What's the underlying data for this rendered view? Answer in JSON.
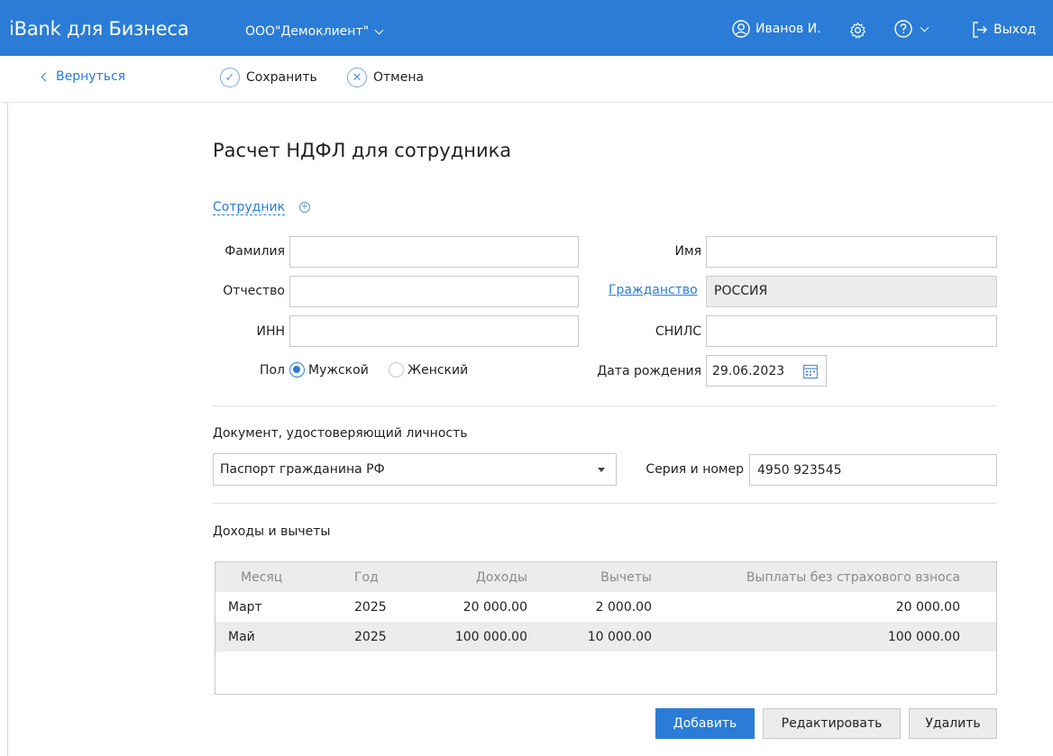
{
  "header": {
    "brand": "iBank для Бизнеса",
    "org": "ООО\"Демоклиент\"",
    "user": "Иванов И.",
    "logout": "Выход"
  },
  "toolbar": {
    "back": "Вернуться",
    "save": "Сохранить",
    "cancel": "Отмена"
  },
  "form": {
    "title": "Расчет НДФЛ для сотрудника",
    "employee_section": "Сотрудник",
    "labels": {
      "last_name": "Фамилия",
      "first_name": "Имя",
      "middle_name": "Отчество",
      "citizenship": "Гражданство",
      "inn": "ИНН",
      "snils": "СНИЛС",
      "gender": "Пол",
      "male": "Мужской",
      "female": "Женский",
      "birth_date": "Дата рождения"
    },
    "values": {
      "last_name": "",
      "first_name": "",
      "middle_name": "",
      "citizenship": "РОССИЯ",
      "inn": "",
      "snils": "",
      "gender": "male",
      "birth_date": "29.06.2023"
    },
    "doc_section": "Документ, удостоверяющий личность",
    "doc_type": "Паспорт гражданина РФ",
    "series_label": "Серия и номер",
    "series_value": "4950 923545",
    "income_section": "Доходы и вычеты"
  },
  "table": {
    "columns": [
      "Месяц",
      "Год",
      "Доходы",
      "Вычеты",
      "Выплаты без страхового взноса"
    ],
    "rows": [
      [
        "Март",
        "2025",
        "20 000.00",
        "2 000.00",
        "20 000.00"
      ],
      [
        "Май",
        "2025",
        "100 000.00",
        "10 000.00",
        "100 000.00"
      ]
    ]
  },
  "actions": {
    "add": "Добавить",
    "edit": "Редактировать",
    "delete": "Удалить"
  },
  "colors": {
    "accent": "#2a7cd6",
    "readonly_bg": "#ececec",
    "border": "#c8c8c8"
  }
}
